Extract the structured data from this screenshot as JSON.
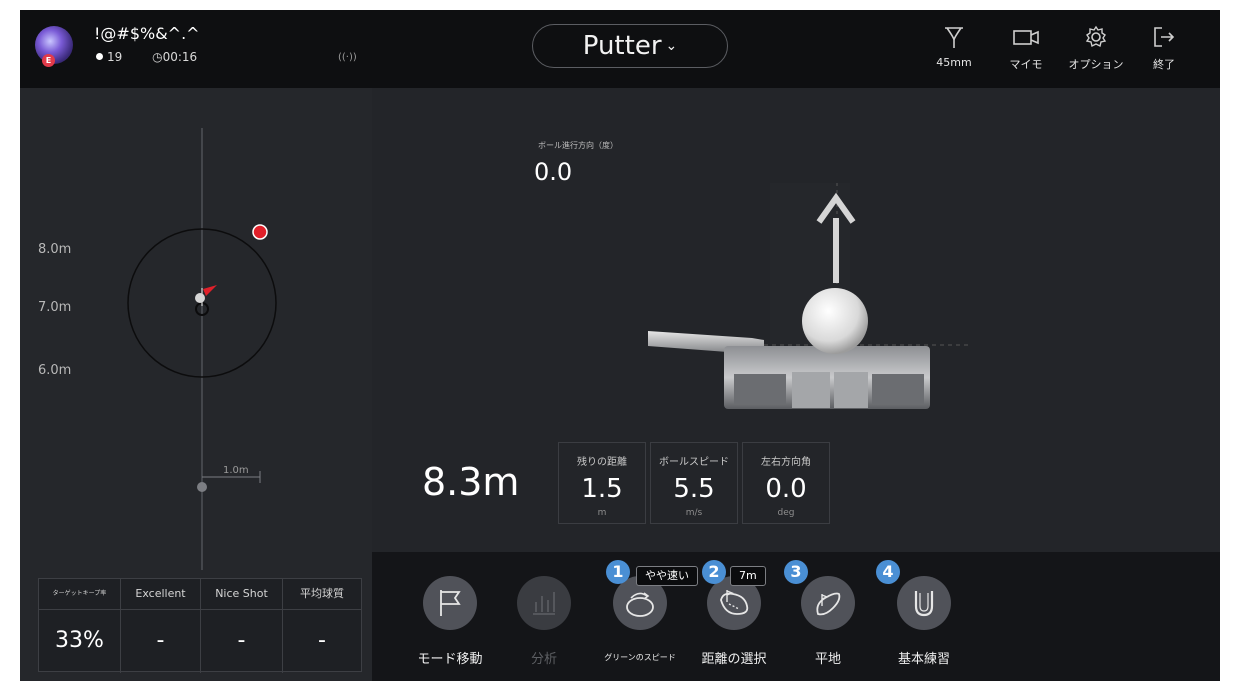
{
  "player": {
    "name": "!@#$%&^.^",
    "badge": "E",
    "shots": "19",
    "timer": "00:16",
    "signal": "((·))"
  },
  "club": {
    "label": "Putter",
    "chevron": "⌄"
  },
  "top_actions": [
    {
      "icon": "tee-icon",
      "label": "45mm"
    },
    {
      "icon": "video-camera-icon",
      "label": "マイモ"
    },
    {
      "icon": "gear-icon",
      "label": "オプション"
    },
    {
      "icon": "exit-icon",
      "label": "終了"
    }
  ],
  "green_map": {
    "distance_labels": [
      "8.0m",
      "7.0m",
      "6.0m"
    ],
    "scale_label": "1.0m"
  },
  "ball_direction": {
    "caption": "ボール進行方向（度）",
    "value": "0.0"
  },
  "shot": {
    "distance": "8.3m",
    "metrics": [
      {
        "label": "残りの距離",
        "value": "1.5",
        "unit": "m"
      },
      {
        "label": "ボールスピード",
        "value": "5.5",
        "unit": "m/s"
      },
      {
        "label": "左右方向角",
        "value": "0.0",
        "unit": "deg"
      }
    ]
  },
  "score_table": {
    "headers": [
      "ターゲットキープ率",
      "Excellent",
      "Nice Shot",
      "平均球質"
    ],
    "values": [
      "33%",
      "-",
      "-",
      "-"
    ]
  },
  "toolbar": {
    "items": [
      {
        "icon": "flag-icon",
        "label": "モード移動"
      },
      {
        "icon": "chart-icon",
        "label": "分析"
      },
      {
        "icon": "green-speed-icon",
        "label": "グリーンのスピード"
      },
      {
        "icon": "distance-select-icon",
        "label": "距離の選択"
      },
      {
        "icon": "flat-green-icon",
        "label": "平地"
      },
      {
        "icon": "basic-practice-icon",
        "label": "基本練習"
      }
    ],
    "badges": [
      "1",
      "2",
      "3",
      "4"
    ],
    "speed_tag": "やや速い",
    "distance_tag": "7m"
  },
  "colors": {
    "accent_badge": "#4a8fd4",
    "ball_marker": "#e0202a",
    "background": "#1d1f23"
  }
}
